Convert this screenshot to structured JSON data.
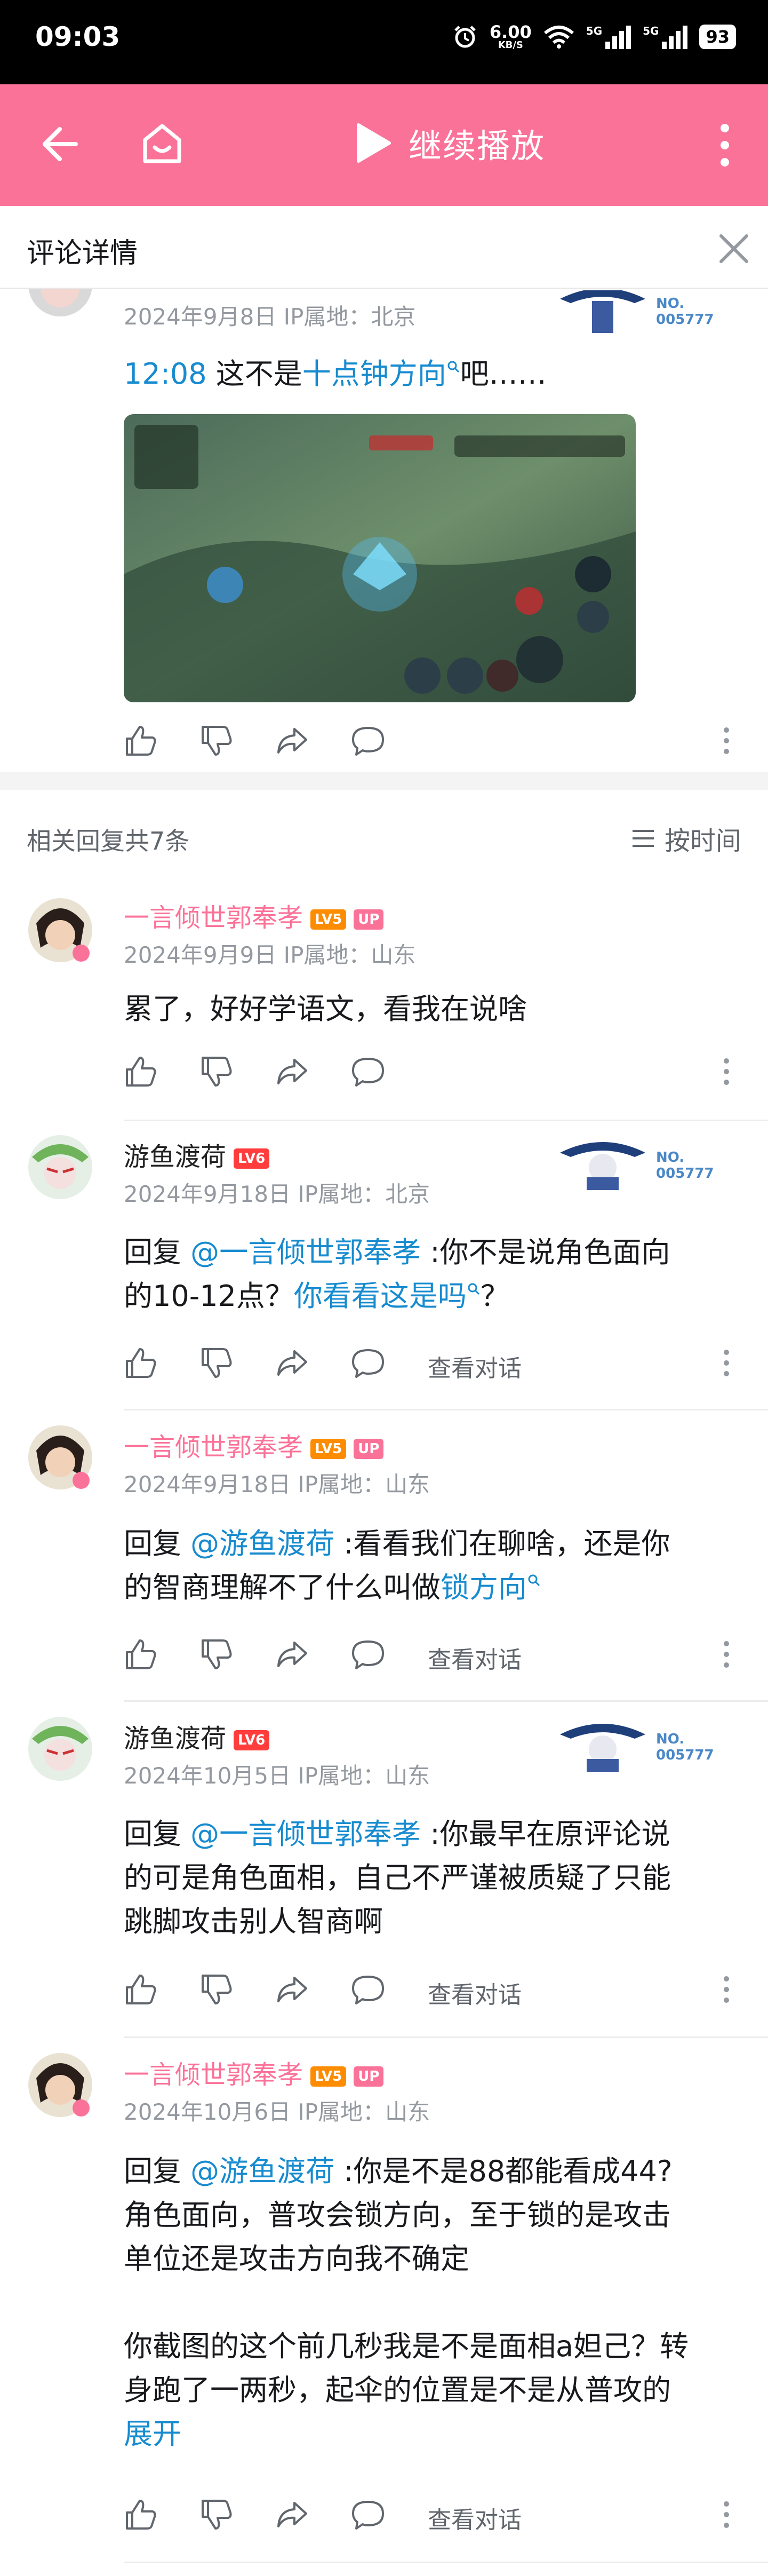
{
  "status_bar": {
    "time": "09:03",
    "net_speed": "6.00",
    "net_unit": "KB/S",
    "sim1": "5G",
    "sim2": "5G",
    "battery": "93"
  },
  "toolbar": {
    "play_label": "继续播放",
    "accent": "#fb7299"
  },
  "header": {
    "title": "评论详情"
  },
  "main_comment": {
    "meta": "2024年9月8日 IP属地：北京",
    "timestamp_link": "12:08",
    "text_before": " 这不是",
    "link_text": "十点钟方向",
    "text_after": "吧……",
    "fan_no": "NO.\n005777"
  },
  "replies_header": {
    "count_label": "相关回复共7条",
    "sort_label": "按时间"
  },
  "replies": [
    {
      "username": "一言倾世郭奉孝",
      "level": "LV5",
      "badge": "UP",
      "meta": "2024年9月9日 IP属地：山东",
      "text": "累了，好好学语文，看我在说啥"
    },
    {
      "username": "游鱼渡荷",
      "level": "LV6",
      "meta": "2024年9月18日 IP属地：北京",
      "reply_prefix": "回复 ",
      "mention": "@一言倾世郭奉孝",
      "text_line1_rest": " :你不是说角色面向",
      "text_line2_pre": "的10-12点？",
      "text_line2_link": "你看看这是吗",
      "text_line2_post": "？",
      "view_conv": "查看对话",
      "fan_no": "NO.\n005777"
    },
    {
      "username": "一言倾世郭奉孝",
      "level": "LV5",
      "badge": "UP",
      "meta": "2024年9月18日 IP属地：山东",
      "reply_prefix": "回复 ",
      "mention": "@游鱼渡荷",
      "text_line1_rest": " :看看我们在聊啥，还是你",
      "text_line2_pre": "的智商理解不了什么叫做",
      "text_line2_link": "锁方向",
      "view_conv": "查看对话"
    },
    {
      "username": "游鱼渡荷",
      "level": "LV6",
      "meta": "2024年10月5日 IP属地：山东",
      "reply_prefix": "回复 ",
      "mention": "@一言倾世郭奉孝",
      "text_line1_rest": " :你最早在原评论说",
      "text_line2": "的可是角色面相，自己不严谨被质疑了只能",
      "text_line3": "跳脚攻击别人智商啊",
      "view_conv": "查看对话",
      "fan_no": "NO.\n005777"
    },
    {
      "username": "一言倾世郭奉孝",
      "level": "LV5",
      "badge": "UP",
      "meta": "2024年10月6日 IP属地：山东",
      "reply_prefix": "回复 ",
      "mention": "@游鱼渡荷",
      "text_line1_rest": " :你是不是88都能看成44?",
      "text_line2": "角色面向，普攻会锁方向，至于锁的是攻击",
      "text_line3": "单位还是攻击方向我不确定",
      "text_line4": "你截图的这个前几秒我是不是面相a妲己？转",
      "text_line5": "身跑了一两秒，起伞的位置是不是从普攻的",
      "text_line6_link": "展开",
      "view_conv": "查看对话"
    }
  ]
}
